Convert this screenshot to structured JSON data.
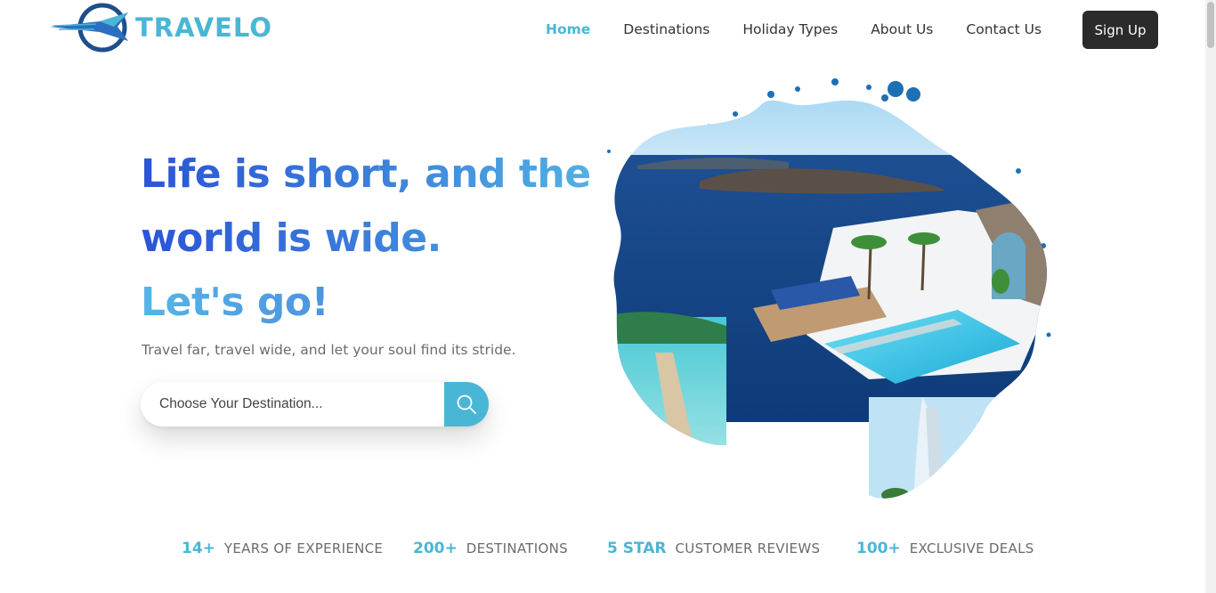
{
  "brand": {
    "name": "TRAVELO"
  },
  "nav": {
    "items": [
      {
        "label": "Home",
        "active": true
      },
      {
        "label": "Destinations",
        "active": false
      },
      {
        "label": "Holiday Types",
        "active": false
      },
      {
        "label": "About Us",
        "active": false
      },
      {
        "label": "Contact Us",
        "active": false
      }
    ],
    "signup_label": "Sign Up"
  },
  "hero": {
    "headline": [
      "Life is short, and the",
      "world is wide.",
      "Let's go!"
    ],
    "subtitle": "Travel far, travel wide, and let your soul find its stride.",
    "search": {
      "placeholder": "Choose Your Destination...",
      "value": "",
      "icon": "search-icon"
    }
  },
  "stats": [
    {
      "number": "14+",
      "label": "YEARS OF EXPERIENCE"
    },
    {
      "number": "200+",
      "label": "DESTINATIONS"
    },
    {
      "number": "5 STAR",
      "label": "CUSTOMER REVIEWS"
    },
    {
      "number": "100+",
      "label": "EXCLUSIVE DEALS"
    }
  ],
  "colors": {
    "accent": "#4ab6d6",
    "dark_button": "#2b2b2b",
    "headline_start": "#2b54d8",
    "headline_end": "#52b4e4",
    "text_muted": "#6b6b6b"
  }
}
